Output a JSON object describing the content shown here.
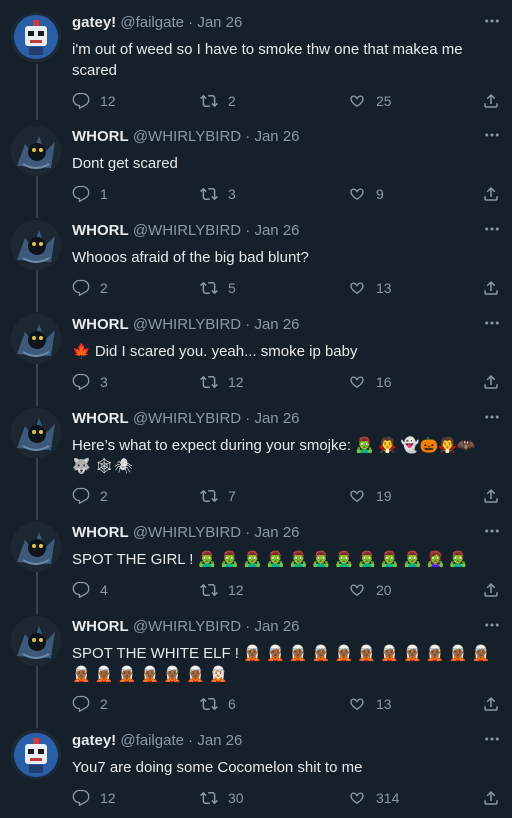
{
  "tweets": [
    {
      "name": "gatey!",
      "handle": "@failgate",
      "date": "Jan 26",
      "text": "i'm out of weed so I have to smoke thw one that makea me scared",
      "replies": "12",
      "retweets": "2",
      "likes": "25",
      "avatar": "robot-avatar"
    },
    {
      "name": "WHORL",
      "handle": "@WHIRLYBIRD",
      "date": "Jan 26",
      "text": "Dont get scared",
      "replies": "1",
      "retweets": "3",
      "likes": "9",
      "avatar": "dark-creature-avatar"
    },
    {
      "name": "WHORL",
      "handle": "@WHIRLYBIRD",
      "date": "Jan 26",
      "text": "Whooos afraid of the big bad blunt?",
      "replies": "2",
      "retweets": "5",
      "likes": "13",
      "avatar": "dark-creature-avatar"
    },
    {
      "name": "WHORL",
      "handle": "@WHIRLYBIRD",
      "date": "Jan 26",
      "text": "🍁 Did I scared you. yeah... smoke ip baby",
      "replies": "3",
      "retweets": "12",
      "likes": "16",
      "avatar": "dark-creature-avatar"
    },
    {
      "name": "WHORL",
      "handle": "@WHIRLYBIRD",
      "date": "Jan 26",
      "text": "Here’s what to expect during your smojke: 🧟‍♂️ 🧛 👻🎃🧛🦇🐺 🕸🕷",
      "replies": "2",
      "retweets": "7",
      "likes": "19",
      "avatar": "dark-creature-avatar"
    },
    {
      "name": "WHORL",
      "handle": "@WHIRLYBIRD",
      "date": "Jan 26",
      "text": "SPOT THE GIRL ! 🧟‍♂️ 🧟‍♂️ 🧟‍♂️ 🧟‍♂️ 🧟‍♂️ 🧟‍♂️ 🧟‍♂️ 🧟‍♂️ 🧟‍♂️ 🧟‍♂️ 🧟‍♀️ 🧟‍♂️",
      "replies": "4",
      "retweets": "12",
      "likes": "20",
      "avatar": "dark-creature-avatar"
    },
    {
      "name": "WHORL",
      "handle": "@WHIRLYBIRD",
      "date": "Jan 26",
      "text": "SPOT THE WHITE ELF ! 🧝🏾 🧝🏾 🧝🏾 🧝🏾 🧝🏾 🧝🏾 🧝🏾 🧝🏾 🧝🏾 🧝🏾 🧝🏾 🧝🏾 🧝🏾 🧝🏾 🧝🏾 🧝🏾 🧝🏾 🧝🏻",
      "replies": "2",
      "retweets": "6",
      "likes": "13",
      "avatar": "dark-creature-avatar"
    },
    {
      "name": "gatey!",
      "handle": "@failgate",
      "date": "Jan 26",
      "text": "You7 are doing some Cocomelon shit to me",
      "replies": "12",
      "retweets": "30",
      "likes": "314",
      "avatar": "robot-avatar"
    }
  ],
  "icons": {
    "reply": "reply-icon",
    "retweet": "retweet-icon",
    "like": "like-icon",
    "share": "share-icon",
    "more": "more-icon"
  },
  "colors": {
    "background": "#15202b",
    "text": "#e7e9ea",
    "muted": "#8b98a5",
    "rail": "#38444d"
  }
}
